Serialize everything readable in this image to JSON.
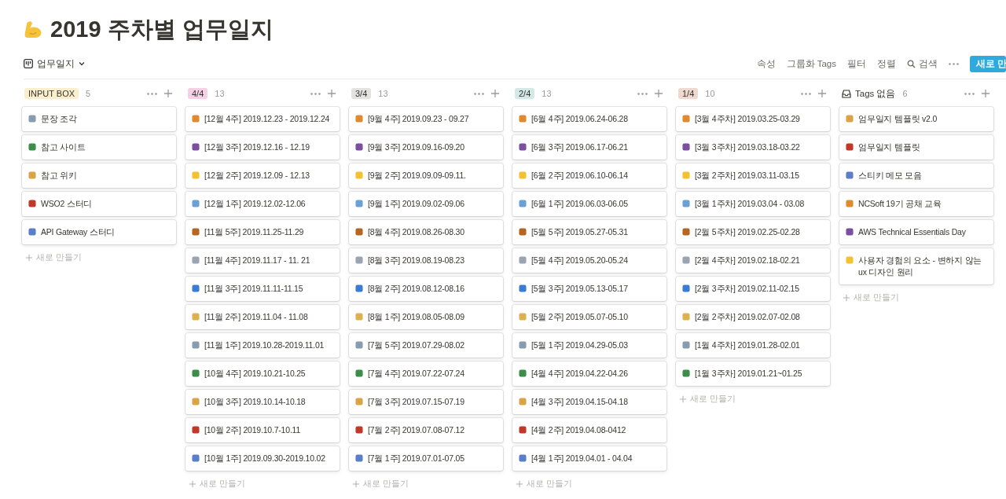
{
  "page": {
    "title": "2019 주차별 업무일지"
  },
  "view": {
    "name": "업무일지"
  },
  "toolbar": {
    "items": [
      {
        "label": "속성",
        "kind": "text"
      },
      {
        "label": "그룹화 Tags",
        "kind": "text"
      },
      {
        "label": "필터",
        "kind": "text"
      },
      {
        "label": "정렬",
        "kind": "text"
      },
      {
        "label": "검색",
        "kind": "search"
      }
    ],
    "new_button": "새로 만"
  },
  "columns": [
    {
      "kind": "tag",
      "label": "INPUT BOX",
      "color": "#fbeecc",
      "count": "5",
      "add_label": "새로 만들기",
      "cards": [
        "문장 조각",
        "참고 사이트",
        "참고 위키",
        "WSO2 스터디",
        "API Gateway 스터디"
      ]
    },
    {
      "kind": "tag",
      "label": "4/4",
      "color": "#f5d0e6",
      "count": "13",
      "add_label": "새로 만들기",
      "cards": [
        "[12월 4주] 2019.12.23 - 2019.12.24",
        "[12월 3주] 2019.12.16 - 12.19",
        "[12월 2주] 2019.12.09 - 12.13",
        "[12월 1주] 2019.12.02-12.06",
        "[11월 5주] 2019.11.25-11.29",
        "[11월 4주] 2019.11.17 - 11. 21",
        "[11월 3주] 2019.11.11-11.15",
        "[11월 2주] 2019.11.04 - 11.08",
        "[11월 1주] 2019.10.28-2019.11.01",
        "[10월 4주] 2019.10.21-10.25",
        "[10월 3주] 2019.10.14-10.18",
        "[10월 2주] 2019.10.7-10.11",
        "[10월 1주] 2019.09.30-2019.10.02"
      ]
    },
    {
      "kind": "tag",
      "label": "3/4",
      "color": "#e3e2e0",
      "count": "13",
      "add_label": "새로 만들기",
      "cards": [
        "[9월 4주] 2019.09.23 - 09.27",
        "[9월 3주] 2019.09.16-09.20",
        "[9월 2주] 2019.09.09-09.11.",
        "[9월 1주] 2019.09.02-09.06",
        "[8월 4주] 2019.08.26-08.30",
        "[8월 3주] 2019.08.19-08.23",
        "[8월 2주] 2019.08.12-08.16",
        "[8월 1주] 2019.08.05-08.09",
        "[7월 5주] 2019.07.29-08.02",
        "[7월 4주] 2019.07.22-07.24",
        "[7월 3주] 2019.07.15-07.19",
        "[7월 2주] 2019.07.08-07.12",
        "[7월 1주] 2019.07.01-07.05"
      ]
    },
    {
      "kind": "tag",
      "label": "2/4",
      "color": "#d3e9e5",
      "count": "13",
      "add_label": "새로 만들기",
      "cards": [
        "[6월 4주] 2019.06.24-06.28",
        "[6월 3주] 2019.06.17-06.21",
        "[6월 2주] 2019.06.10-06.14",
        "[6월 1주] 2019.06.03-06.05",
        "[5월 5주] 2019.05.27-05.31",
        "[5월 4주] 2019.05.20-05.24",
        "[5월 3주] 2019.05.13-05.17",
        "[5월 2주] 2019.05.07-05.10",
        "[5월 1주] 2019.04.29-05.03",
        "[4월 4주] 2019.04.22-04.26",
        "[4월 3주] 2019.04.15-04.18",
        "[4월 2주] 2019.04.08-0412",
        "[4월 1주] 2019.04.01 - 04.04"
      ]
    },
    {
      "kind": "tag",
      "label": "1/4",
      "color": "#eed8cf",
      "count": "10",
      "add_label": "새로 만들기",
      "cards": [
        "[3월 4주차] 2019.03.25-03.29",
        "[3월 3주차] 2019.03.18-03.22",
        "[3월 2주차] 2019.03.11-03.15",
        "[3월 1주차] 2019.03.04 - 03.08",
        "[2월 5주차] 2019.02.25-02.28",
        "[2월 4주차] 2019.02.18-02.21",
        "[2월 3주차] 2019.02.11-02.15",
        "[2월 2주차] 2019.02.07-02.08",
        "[1월 4주차] 2019.01.28-02.01",
        "[1월 3주차] 2019.01.21~01.25"
      ]
    },
    {
      "kind": "untagged",
      "label": "Tags 없음",
      "count": "6",
      "add_label": "새로 만들기",
      "cards": [
        "엄무일지 템플릿 v2.0",
        "엄무일지 템플릿",
        "스티키 메모 모음",
        "NCSoft 19기 공채 교육",
        "AWS Technical Essentials Day",
        "사용자 경험의 요소 - 변하지 않는 ux 디자인 원리"
      ]
    }
  ]
}
